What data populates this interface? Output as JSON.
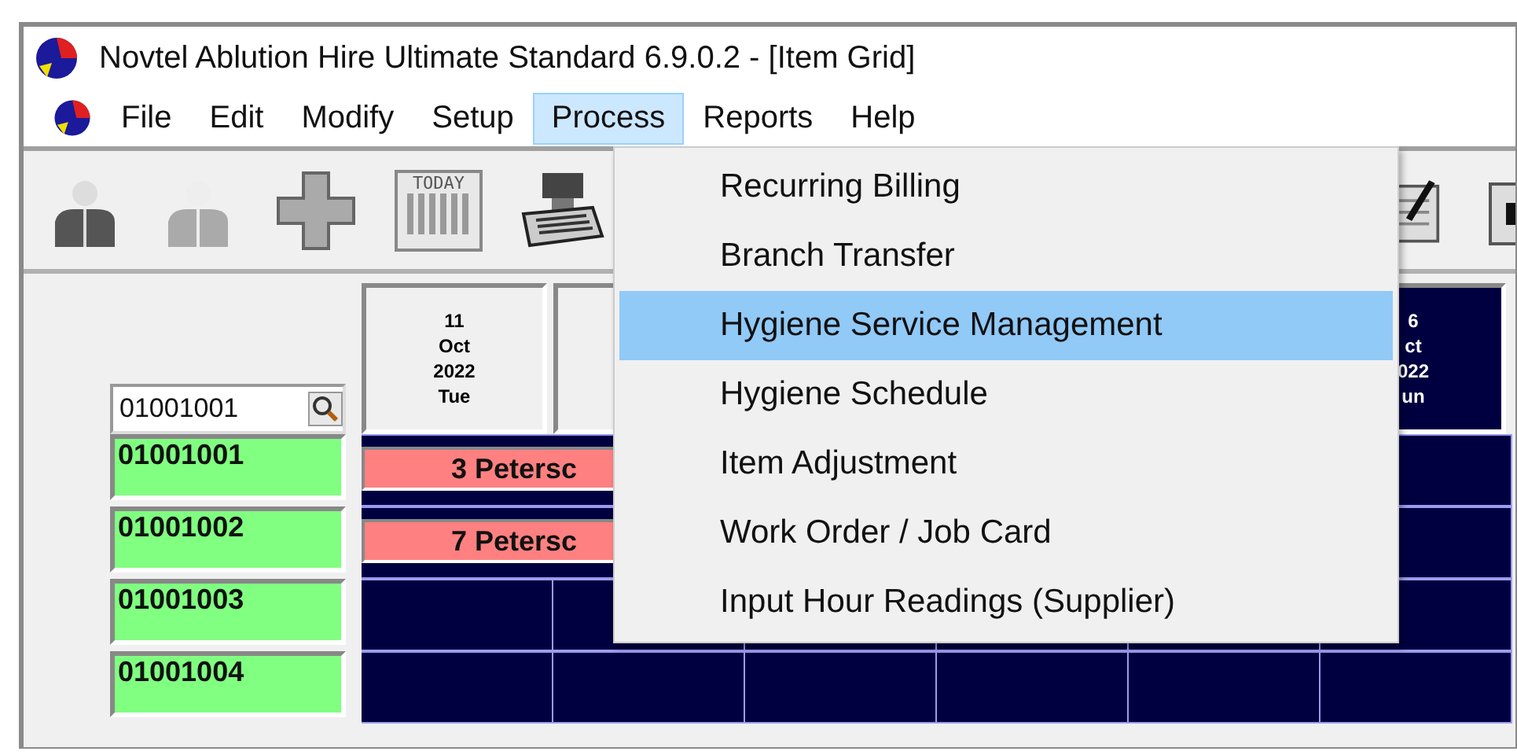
{
  "window": {
    "title": "Novtel Ablution Hire Ultimate Standard 6.9.0.2 - [Item Grid]"
  },
  "menu_bar": [
    {
      "label": "File",
      "selected": false
    },
    {
      "label": "Edit",
      "selected": false
    },
    {
      "label": "Modify",
      "selected": false
    },
    {
      "label": "Setup",
      "selected": false
    },
    {
      "label": "Process",
      "selected": true
    },
    {
      "label": "Reports",
      "selected": false
    },
    {
      "label": "Help",
      "selected": false
    }
  ],
  "toolbar": {
    "calendar_icon_text": "TODAY"
  },
  "process_menu": [
    {
      "label": "Recurring Billing",
      "selected": false
    },
    {
      "label": "Branch Transfer",
      "selected": false
    },
    {
      "label": "Hygiene Service Management",
      "selected": true
    },
    {
      "label": "Hygiene Schedule",
      "selected": false
    },
    {
      "label": "Item Adjustment",
      "selected": false
    },
    {
      "label": "Work Order / Job Card",
      "selected": false
    },
    {
      "label": "Input Hour Readings (Supplier)",
      "selected": false
    }
  ],
  "item_search": {
    "value": "01001001"
  },
  "date_headers": [
    {
      "lines": [
        "11",
        "Oct",
        "2022",
        "Tue"
      ],
      "highlighted": false
    },
    {
      "highlighted": false
    },
    {
      "lines": [
        "6",
        "ct",
        "022",
        "un"
      ],
      "highlighted": true
    }
  ],
  "rows": [
    {
      "code": "01001001",
      "booking": "3 Petersc"
    },
    {
      "code": "01001002",
      "booking": "7 Petersc"
    },
    {
      "code": "01001003"
    },
    {
      "code": "01001004"
    }
  ]
}
